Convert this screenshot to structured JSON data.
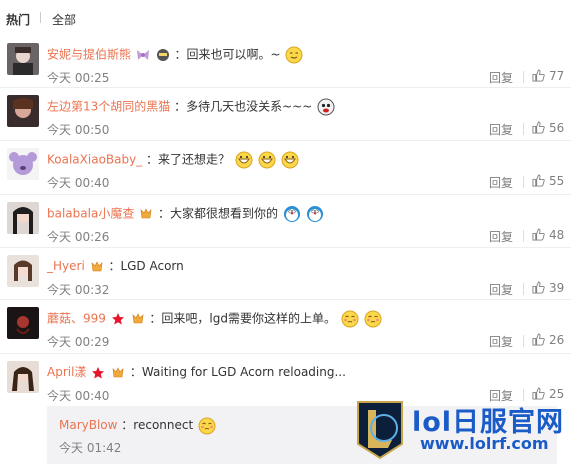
{
  "tabs": {
    "hot": "热门",
    "all": "全部"
  },
  "comments": [
    {
      "user": "安妮与提伯斯熊",
      "text": "：回来也可以啊。~",
      "time": "今天 00:25",
      "reply": "回复",
      "likes": "77"
    },
    {
      "user": "左边第13个胡同的黑猫",
      "text": "：多待几天也没关系~~~",
      "time": "今天 00:50",
      "reply": "回复",
      "likes": "56"
    },
    {
      "user": "KoalaXiaoBaby_",
      "text": "：来了还想走？",
      "time": "今天 00:40",
      "reply": "回复",
      "likes": "55"
    },
    {
      "user": "balabala小魔查",
      "text": "：大家都很想看到你的",
      "time": "今天 00:26",
      "reply": "回复",
      "likes": "48"
    },
    {
      "user": "_Hyeri",
      "text": "：LGD Acorn",
      "time": "今天 00:32",
      "reply": "回复",
      "likes": "39"
    },
    {
      "user": "蘑菇、999",
      "text": "：回来吧，lgd需要你这样的上单。",
      "time": "今天 00:29",
      "reply": "回复",
      "likes": "26"
    },
    {
      "user": "April漾",
      "text": "：Waiting for LGD Acorn reloading...",
      "time": "今天 00:40",
      "reply": "回复",
      "likes": "25"
    }
  ],
  "subreply": {
    "user": "MaryBlow",
    "text": "：reconnect",
    "time": "今天 01:42"
  },
  "watermark": {
    "title": "lol日服官网",
    "url": "www.lolrf.com"
  },
  "colors": {
    "username": "#eb7350",
    "meta": "#808080",
    "watermark": "#1a5bc8"
  }
}
